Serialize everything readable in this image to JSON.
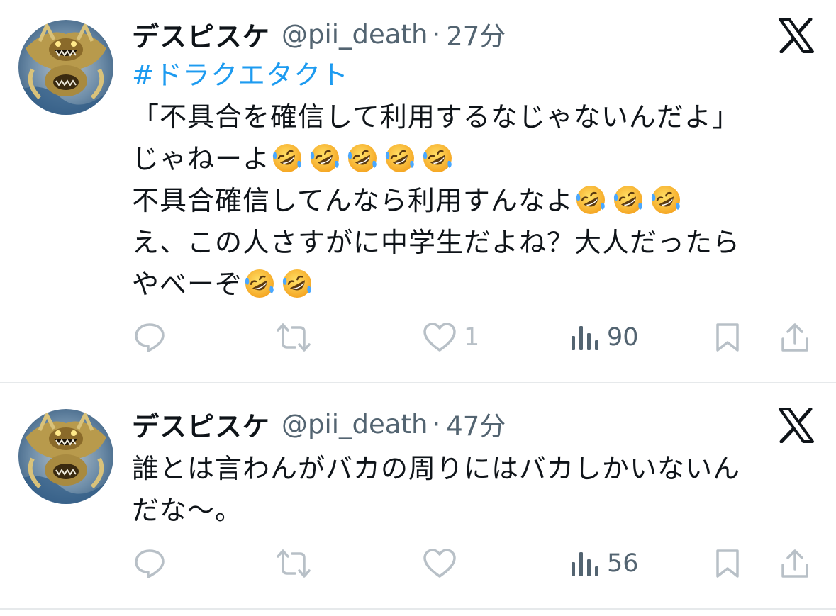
{
  "tweets": [
    {
      "author_name": "デスピスケ",
      "handle": "@pii_death",
      "separator": "·",
      "time": "27分",
      "hashtag": "#ドラクエタクト",
      "lines": [
        "「不具合を確信して利用するなじゃないんだよ」",
        "じゃねーよ",
        "不具合確信してんなら利用すんなよ",
        "え、この人さすがに中学生だよね？大人だったら",
        "やべーぞ"
      ],
      "emoji_name": "rolling-on-the-floor-laughing",
      "likes": "1",
      "views": "90"
    },
    {
      "author_name": "デスピスケ",
      "handle": "@pii_death",
      "separator": "·",
      "time": "47分",
      "lines": [
        "誰とは言わんがバカの周りにはバカしかいないん",
        "だな〜。"
      ],
      "views": "56"
    }
  ],
  "icons": {
    "reply": "reply-icon",
    "retweet": "retweet-icon",
    "like": "heart-icon",
    "views": "views-icon",
    "bookmark": "bookmark-icon",
    "share": "share-icon",
    "platform": "x-logo-icon"
  },
  "colors": {
    "text": "#0f1419",
    "secondary": "#536471",
    "link": "#1d9bf0",
    "icon_gray": "#b8c0c7",
    "divider": "#e6e9eb"
  }
}
